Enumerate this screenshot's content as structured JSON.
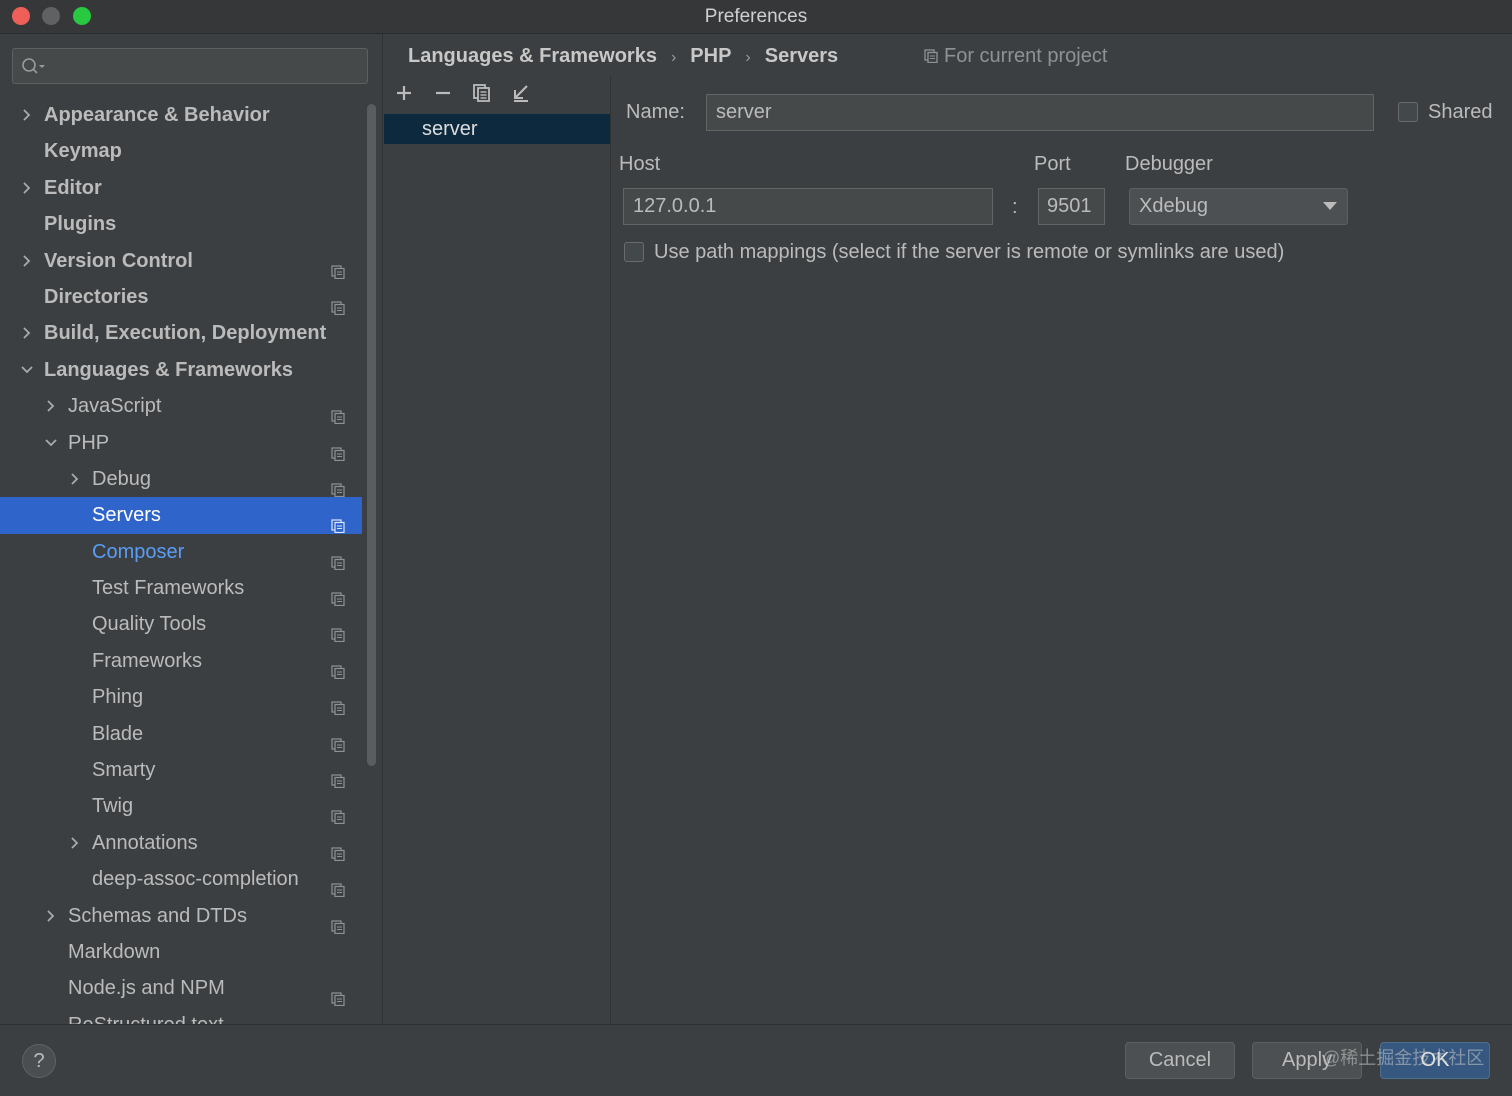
{
  "window": {
    "title": "Preferences"
  },
  "search": {
    "placeholder": ""
  },
  "sidebar": {
    "items": [
      {
        "label": "Appearance & Behavior",
        "level": 0,
        "arrow": "right",
        "bold": true,
        "proj": false
      },
      {
        "label": "Keymap",
        "level": 0,
        "arrow": "none",
        "bold": true,
        "proj": false
      },
      {
        "label": "Editor",
        "level": 0,
        "arrow": "right",
        "bold": true,
        "proj": false
      },
      {
        "label": "Plugins",
        "level": 0,
        "arrow": "none",
        "bold": true,
        "proj": false
      },
      {
        "label": "Version Control",
        "level": 0,
        "arrow": "right",
        "bold": true,
        "proj": true
      },
      {
        "label": "Directories",
        "level": 0,
        "arrow": "none",
        "bold": true,
        "proj": true
      },
      {
        "label": "Build, Execution, Deployment",
        "level": 0,
        "arrow": "right",
        "bold": true,
        "proj": false
      },
      {
        "label": "Languages & Frameworks",
        "level": 0,
        "arrow": "down",
        "bold": true,
        "proj": false
      },
      {
        "label": "JavaScript",
        "level": 1,
        "arrow": "right",
        "bold": false,
        "proj": true
      },
      {
        "label": "PHP",
        "level": 1,
        "arrow": "down",
        "bold": false,
        "proj": true
      },
      {
        "label": "Debug",
        "level": 2,
        "arrow": "right",
        "bold": false,
        "proj": true
      },
      {
        "label": "Servers",
        "level": 2,
        "arrow": "none",
        "bold": false,
        "proj": true,
        "selected": true
      },
      {
        "label": "Composer",
        "level": 2,
        "arrow": "none",
        "bold": false,
        "proj": true,
        "link": true
      },
      {
        "label": "Test Frameworks",
        "level": 2,
        "arrow": "none",
        "bold": false,
        "proj": true
      },
      {
        "label": "Quality Tools",
        "level": 2,
        "arrow": "none",
        "bold": false,
        "proj": true
      },
      {
        "label": "Frameworks",
        "level": 2,
        "arrow": "none",
        "bold": false,
        "proj": true
      },
      {
        "label": "Phing",
        "level": 2,
        "arrow": "none",
        "bold": false,
        "proj": true
      },
      {
        "label": "Blade",
        "level": 2,
        "arrow": "none",
        "bold": false,
        "proj": true
      },
      {
        "label": "Smarty",
        "level": 2,
        "arrow": "none",
        "bold": false,
        "proj": true
      },
      {
        "label": "Twig",
        "level": 2,
        "arrow": "none",
        "bold": false,
        "proj": true
      },
      {
        "label": "Annotations",
        "level": 2,
        "arrow": "right",
        "bold": false,
        "proj": true
      },
      {
        "label": "deep-assoc-completion",
        "level": 2,
        "arrow": "none",
        "bold": false,
        "proj": true
      },
      {
        "label": "Schemas and DTDs",
        "level": 1,
        "arrow": "right",
        "bold": false,
        "proj": true
      },
      {
        "label": "Markdown",
        "level": 1,
        "arrow": "none",
        "bold": false,
        "proj": false
      },
      {
        "label": "Node.js and NPM",
        "level": 1,
        "arrow": "none",
        "bold": false,
        "proj": true
      },
      {
        "label": "ReStructured text",
        "level": 1,
        "arrow": "none",
        "bold": false,
        "proj": false
      }
    ]
  },
  "breadcrumb": {
    "items": [
      "Languages & Frameworks",
      "PHP",
      "Servers"
    ],
    "separator": "›"
  },
  "scope": {
    "label": "For current project"
  },
  "servers": {
    "items": [
      "server"
    ]
  },
  "form": {
    "name_label": "Name:",
    "name_value": "server",
    "shared_label": "Shared",
    "host_label": "Host",
    "host_value": "127.0.0.1",
    "port_label": "Port",
    "port_value": "9501",
    "colon": ":",
    "debugger_label": "Debugger",
    "debugger_value": "Xdebug",
    "path_mappings_label": "Use path mappings (select if the server is remote or symlinks are used)"
  },
  "footer": {
    "help_label": "?",
    "cancel_label": "Cancel",
    "apply_label": "Apply",
    "ok_label": "OK",
    "watermark": "@稀土掘金技术社区"
  },
  "colors": {
    "selection": "#2f65ca",
    "link": "#589df6",
    "ok_button": "#365880"
  }
}
